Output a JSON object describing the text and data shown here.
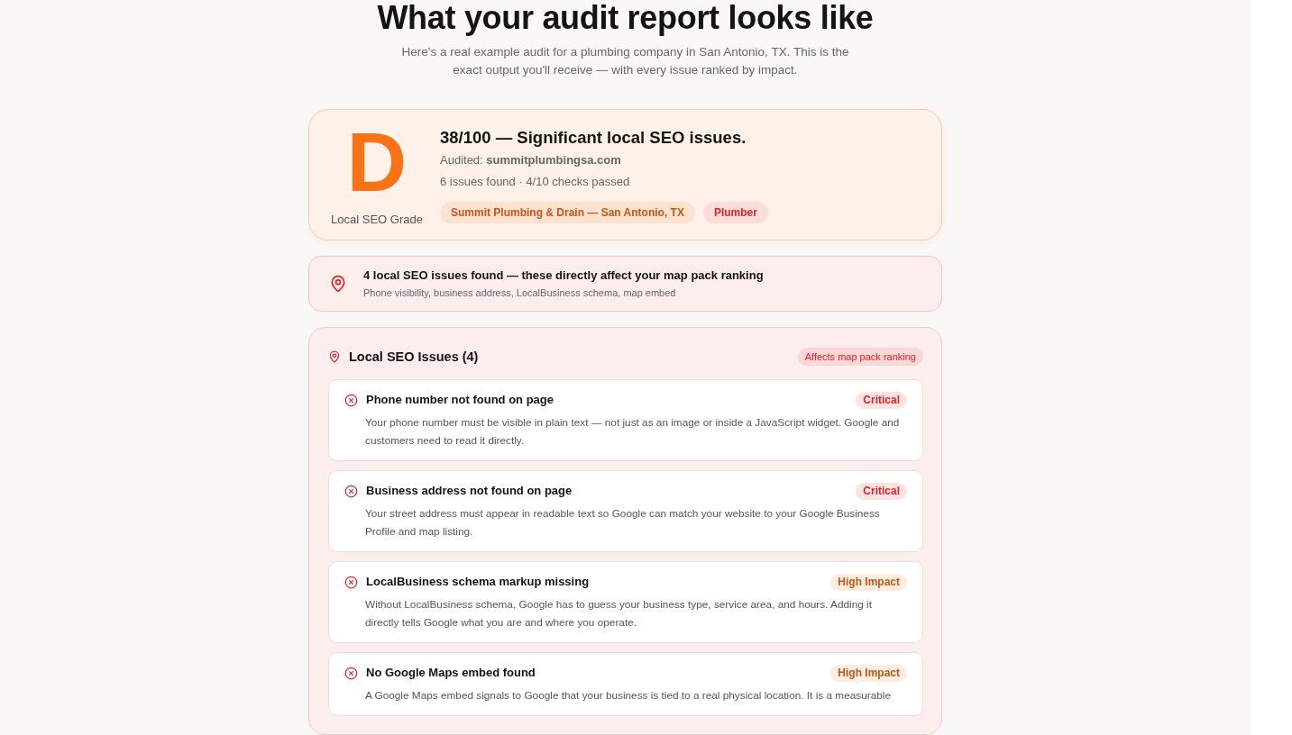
{
  "header": {
    "title": "What your audit report looks like",
    "subtitle": "Here's a real example audit for a plumbing company in San Antonio, TX. This is the exact output you'll receive — with every issue ranked by impact."
  },
  "grade_card": {
    "grade": "D",
    "grade_label": "Local SEO Grade",
    "headline": "38/100 — Significant local SEO issues.",
    "audited": "Audited: **summitplumbingsa.com**",
    "summary": "6 issues found · 4/10 checks passed",
    "tags": [
      {
        "label": "Summit Plumbing & Drain — San Antonio, TX",
        "kind": "business"
      },
      {
        "label": "Plumber",
        "kind": "category"
      }
    ]
  },
  "alert": {
    "title": "4 local SEO issues found — these directly affect your map pack ranking",
    "detail": "Phone visibility, business address, LocalBusiness schema, map embed"
  },
  "issues_panel": {
    "title": "Local SEO Issues (4)",
    "badge": "Affects map pack ranking",
    "issues": [
      {
        "title": "Phone number not found on page",
        "badge": "Critical",
        "kind": "critical",
        "description": "Your phone number must be visible in plain text — not just as an image or inside a JavaScript widget. Google and customers need to read it directly."
      },
      {
        "title": "Business address not found on page",
        "badge": "Critical",
        "kind": "critical",
        "description": "Your street address must appear in readable text so Google can match your website to your Google Business Profile and map listing."
      },
      {
        "title": "LocalBusiness schema markup missing",
        "badge": "High Impact",
        "kind": "high",
        "description": "Without LocalBusiness schema, Google has to guess your business type, service area, and hours. Adding it directly tells Google what you are and where you operate."
      },
      {
        "title": "No Google Maps embed found",
        "badge": "High Impact",
        "kind": "high",
        "description": "A Google Maps embed signals to Google that your business is tied to a real physical location. It is a measurable"
      }
    ]
  }
}
